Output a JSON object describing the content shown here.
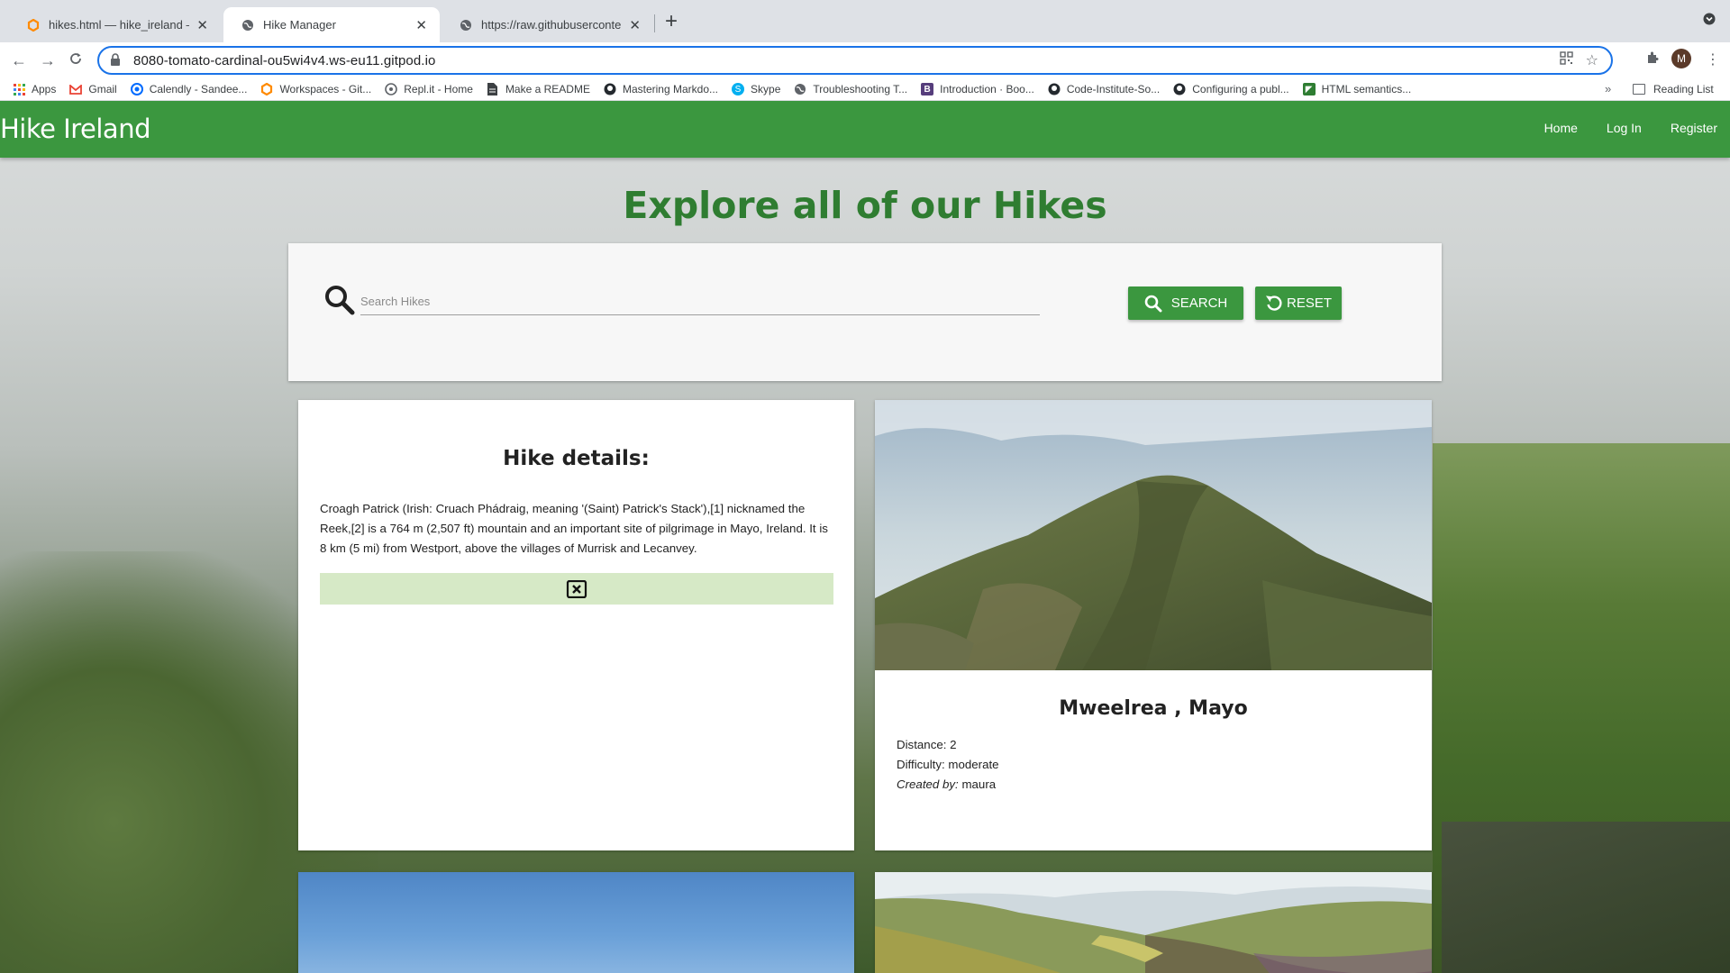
{
  "browser": {
    "tabs": [
      {
        "title": "hikes.html — hike_ireland — Gi",
        "icon": "gitpod-icon",
        "active": false
      },
      {
        "title": "Hike Manager",
        "icon": "globe-icon",
        "active": true
      },
      {
        "title": "https://raw.githubusercontent.c",
        "icon": "globe-icon",
        "active": false
      }
    ],
    "url": "8080-tomato-cardinal-ou5wi4v4.ws-eu11.gitpod.io",
    "avatar_letter": "M",
    "bookmarks": [
      {
        "label": "Apps",
        "icon": "apps-grid-icon",
        "color": "#4285f4"
      },
      {
        "label": "Gmail",
        "icon": "gmail-icon",
        "color": "#ea4335"
      },
      {
        "label": "Calendly - Sandee...",
        "icon": "calendly-icon",
        "color": "#006bff"
      },
      {
        "label": "Workspaces - Git...",
        "icon": "gitpod-icon",
        "color": "#ff8a00"
      },
      {
        "label": "Repl.it - Home",
        "icon": "replit-icon",
        "color": "#5f6368"
      },
      {
        "label": "Make a README",
        "icon": "document-icon",
        "color": "#3c4043"
      },
      {
        "label": "Mastering Markdo...",
        "icon": "github-icon",
        "color": "#24292e"
      },
      {
        "label": "Skype",
        "icon": "skype-icon",
        "color": "#00aff0"
      },
      {
        "label": "Troubleshooting T...",
        "icon": "globe-icon",
        "color": "#5f6368"
      },
      {
        "label": "Introduction · Boo...",
        "icon": "bootstrap-icon",
        "color": "#563d7c"
      },
      {
        "label": "Code-Institute-So...",
        "icon": "github-icon",
        "color": "#24292e"
      },
      {
        "label": "Configuring a publ...",
        "icon": "github-icon",
        "color": "#24292e"
      },
      {
        "label": "HTML semantics...",
        "icon": "html-icon",
        "color": "#2e7d32"
      }
    ],
    "more_bookmarks": "»",
    "reading_list": "Reading List"
  },
  "site": {
    "brand": "Hike Ireland",
    "nav": [
      "Home",
      "Log In",
      "Register"
    ],
    "accent_color": "#3b973f",
    "title": "Explore all of our Hikes"
  },
  "search": {
    "placeholder": "Search Hikes",
    "value": "",
    "search_label": "Search",
    "reset_label": "Reset"
  },
  "details_card": {
    "title": "Hike details:",
    "text": "Croagh Patrick (Irish: Cruach Phádraig, meaning '(Saint) Patrick's Stack'),[1] nicknamed the Reek,[2] is a 764 m (2,507 ft) mountain and an important site of pilgrimage in Mayo, Ireland. It is 8 km (5 mi) from Westport, above the villages of Murrisk and Lecanvey.",
    "close_icon": "close-box-icon"
  },
  "hike_card": {
    "name": "Mweelrea , Mayo",
    "distance_label": "Distance:",
    "distance_value": "2",
    "difficulty_label": "Difficulty:",
    "difficulty_value": "moderate",
    "created_label": "Created by:",
    "created_value": "maura"
  }
}
